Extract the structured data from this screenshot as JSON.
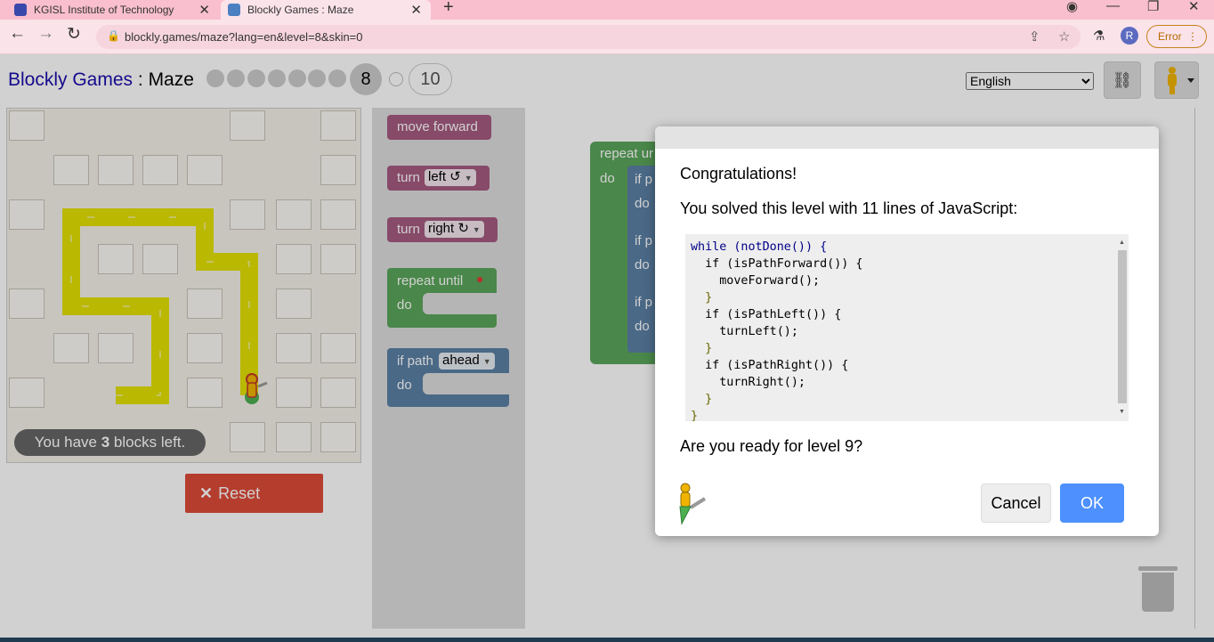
{
  "browser": {
    "tabs": [
      {
        "title": "KGISL Institute of Technology",
        "active": false
      },
      {
        "title": "Blockly Games : Maze",
        "active": true
      }
    ],
    "url": "blockly.games/maze?lang=en&level=8&skin=0",
    "profile_initial": "R",
    "error_label": "Error"
  },
  "header": {
    "brand": "Blockly Games",
    "separator": " : ",
    "game": "Maze",
    "current_level": "8",
    "max_level": "10",
    "language": "English"
  },
  "maze": {
    "hint_prefix": "You have ",
    "hint_count": "3",
    "hint_suffix": " blocks left."
  },
  "reset_label": "Reset",
  "toolbox": {
    "move_forward": "move forward",
    "turn_label": "turn",
    "left": "left ↺",
    "right": "right ↻",
    "repeat_until": "repeat until",
    "do": "do",
    "if_path": "if path",
    "ahead": "ahead"
  },
  "workspace": {
    "repeat_until": "repeat ur",
    "do": "do",
    "if_p": "if p"
  },
  "dialog": {
    "line1": "Congratulations!",
    "line2": "You solved this level with 11 lines of JavaScript:",
    "code": [
      "while (notDone()) {",
      "  if (isPathForward()) {",
      "    moveForward();",
      "  }",
      "  if (isPathLeft()) {",
      "    turnLeft();",
      "  }",
      "  if (isPathRight()) {",
      "    turnRight();",
      "  }",
      "}"
    ],
    "question": "Are you ready for level 9?",
    "cancel": "Cancel",
    "ok": "OK"
  },
  "colors": {
    "move_block": "#a55b80",
    "loop_block": "#5ba55b",
    "logic_block": "#5b80a5",
    "reset": "#dd4b39",
    "ok_button": "#4d90fe",
    "path": "#e8e800"
  },
  "icons": [
    "pegman-icon",
    "link-icon",
    "lock-icon",
    "star-icon",
    "share-icon",
    "trash-icon",
    "marker-icon"
  ]
}
